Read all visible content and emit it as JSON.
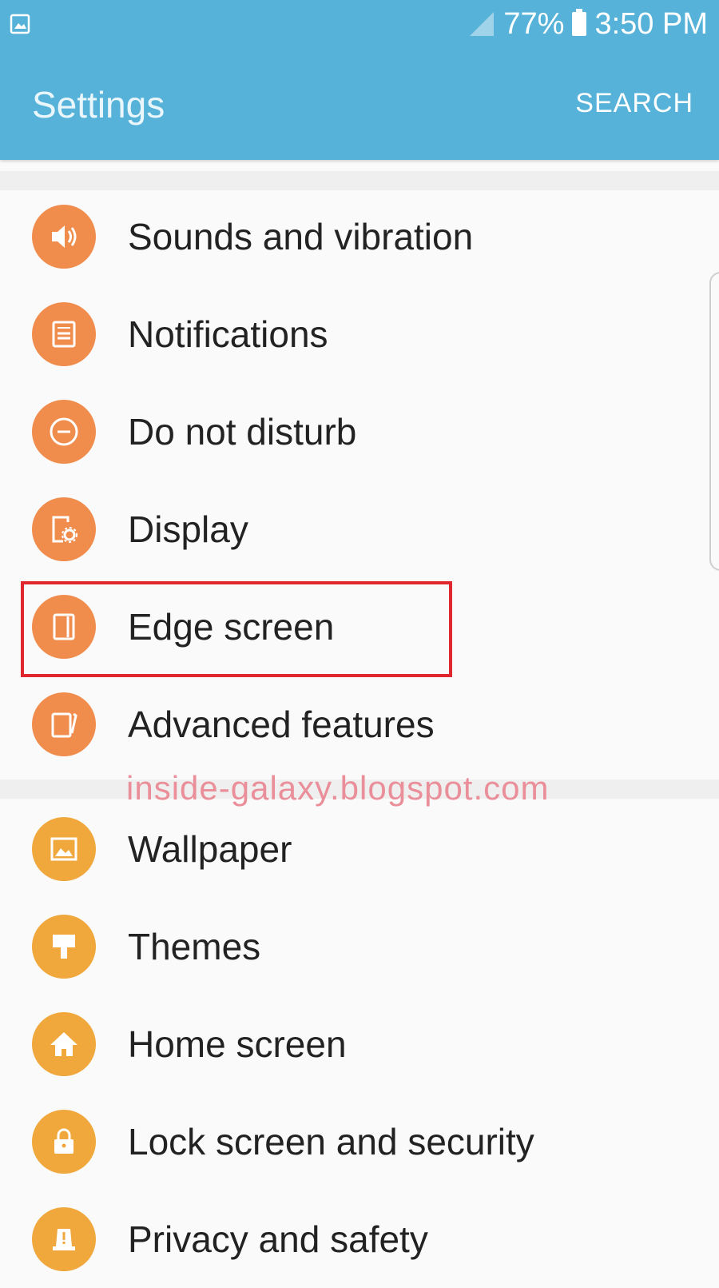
{
  "status_bar": {
    "battery_percent": "77%",
    "time": "3:50 PM",
    "left_icon": "gallery-icon",
    "signal_icon": "signal-icon",
    "battery_icon": "battery-icon"
  },
  "app_bar": {
    "title": "Settings",
    "search_label": "SEARCH",
    "color": "#56b2d8"
  },
  "settings_group_1": [
    {
      "label": "Sounds and vibration",
      "icon": "speaker-icon"
    },
    {
      "label": "Notifications",
      "icon": "notifications-icon"
    },
    {
      "label": "Do not disturb",
      "icon": "do-not-disturb-icon"
    },
    {
      "label": "Display",
      "icon": "display-icon"
    },
    {
      "label": "Edge screen",
      "icon": "edge-screen-icon",
      "highlighted": true
    },
    {
      "label": "Advanced features",
      "icon": "advanced-features-icon"
    }
  ],
  "settings_group_2": [
    {
      "label": "Wallpaper",
      "icon": "wallpaper-icon"
    },
    {
      "label": "Themes",
      "icon": "themes-icon"
    },
    {
      "label": "Home screen",
      "icon": "home-icon"
    },
    {
      "label": "Lock screen and security",
      "icon": "lock-icon"
    },
    {
      "label": "Privacy and safety",
      "icon": "privacy-icon"
    }
  ],
  "watermark": "inside-galaxy.blogspot.com",
  "colors": {
    "group1_icon": "#f18d4c",
    "group2_icon": "#f0a73b",
    "highlight": "#e0272d"
  }
}
